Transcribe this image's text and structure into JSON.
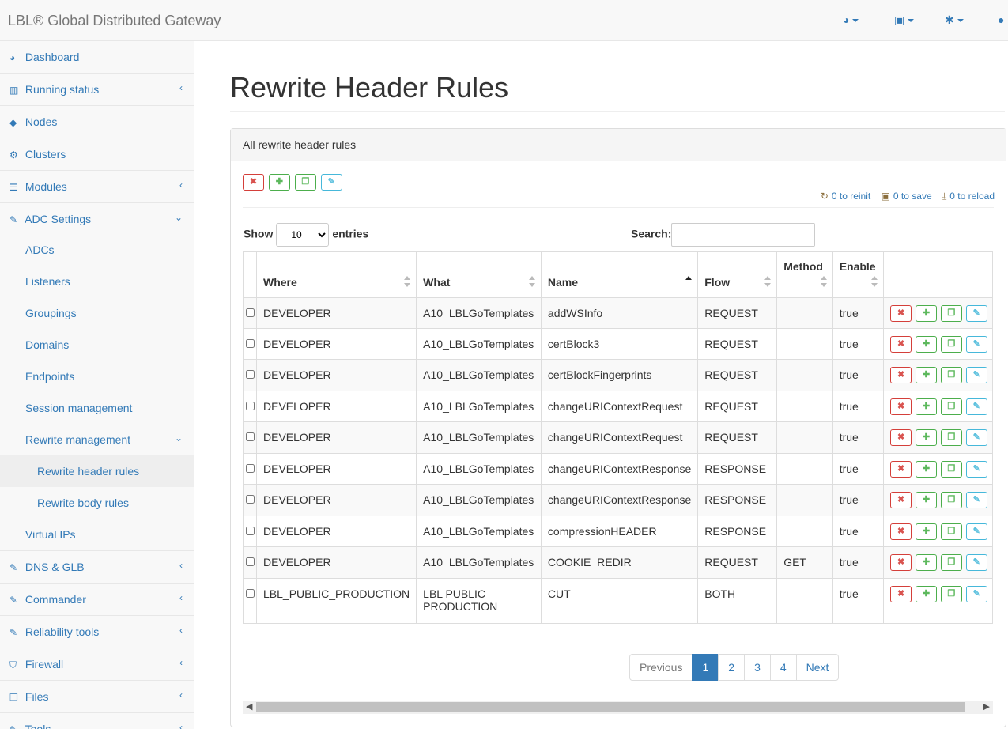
{
  "app": {
    "title": "LBL® Global Distributed Gateway"
  },
  "navbar": {
    "icons": [
      "dashboard-icon",
      "save-icon",
      "gear-icon",
      "user-icon"
    ]
  },
  "sidebar": {
    "items": [
      {
        "label": "Dashboard",
        "icon": "dashboard-icon",
        "chevron": ""
      },
      {
        "label": "Running status",
        "icon": "bar-chart-icon",
        "chevron": "‹"
      },
      {
        "label": "Nodes",
        "icon": "cube-icon",
        "chevron": ""
      },
      {
        "label": "Clusters",
        "icon": "cogs-icon",
        "chevron": ""
      },
      {
        "label": "Modules",
        "icon": "list-icon",
        "chevron": "‹"
      },
      {
        "label": "ADC Settings",
        "icon": "edit-icon",
        "chevron": "⌄"
      }
    ],
    "adc_sub": [
      "ADCs",
      "Listeners",
      "Groupings",
      "Domains",
      "Endpoints",
      "Session management"
    ],
    "rewrite_management": "Rewrite management",
    "rewrite_sub": [
      "Rewrite header rules",
      "Rewrite body rules"
    ],
    "virtual_ips": "Virtual IPs",
    "bottom_items": [
      {
        "label": "DNS & GLB",
        "icon": "edit-icon"
      },
      {
        "label": "Commander",
        "icon": "edit-icon"
      },
      {
        "label": "Reliability tools",
        "icon": "edit-icon"
      },
      {
        "label": "Firewall",
        "icon": "shield-icon"
      },
      {
        "label": "Files",
        "icon": "files-icon"
      },
      {
        "label": "Tools",
        "icon": "wrench-icon"
      }
    ]
  },
  "page": {
    "title": "Rewrite Header Rules",
    "panel_heading": "All rewrite header rules",
    "counters": {
      "reinit": "0 to reinit",
      "save": "0 to save",
      "reload": "0 to reload"
    },
    "length": {
      "show": "Show",
      "value": "10",
      "entries": "entries"
    },
    "search_label": "Search:"
  },
  "table": {
    "headers": [
      "Where",
      "What",
      "Name",
      "Flow",
      "Method",
      "Enable"
    ],
    "rows": [
      {
        "where": "DEVELOPER",
        "what": "A10_LBLGoTemplates",
        "name": "addWSInfo",
        "flow": "REQUEST",
        "method": "",
        "enable": "true"
      },
      {
        "where": "DEVELOPER",
        "what": "A10_LBLGoTemplates",
        "name": "certBlock3",
        "flow": "REQUEST",
        "method": "",
        "enable": "true"
      },
      {
        "where": "DEVELOPER",
        "what": "A10_LBLGoTemplates",
        "name": "certBlockFingerprints",
        "flow": "REQUEST",
        "method": "",
        "enable": "true"
      },
      {
        "where": "DEVELOPER",
        "what": "A10_LBLGoTemplates",
        "name": "changeURIContextRequest",
        "flow": "REQUEST",
        "method": "",
        "enable": "true"
      },
      {
        "where": "DEVELOPER",
        "what": "A10_LBLGoTemplates",
        "name": "changeURIContextRequest",
        "flow": "REQUEST",
        "method": "",
        "enable": "true"
      },
      {
        "where": "DEVELOPER",
        "what": "A10_LBLGoTemplates",
        "name": "changeURIContextResponse",
        "flow": "RESPONSE",
        "method": "",
        "enable": "true"
      },
      {
        "where": "DEVELOPER",
        "what": "A10_LBLGoTemplates",
        "name": "changeURIContextResponse",
        "flow": "RESPONSE",
        "method": "",
        "enable": "true"
      },
      {
        "where": "DEVELOPER",
        "what": "A10_LBLGoTemplates",
        "name": "compressionHEADER",
        "flow": "RESPONSE",
        "method": "",
        "enable": "true"
      },
      {
        "where": "DEVELOPER",
        "what": "A10_LBLGoTemplates",
        "name": "COOKIE_REDIR",
        "flow": "REQUEST",
        "method": "GET",
        "enable": "true"
      },
      {
        "where": "LBL_PUBLIC_PRODUCTION",
        "what": "LBL PUBLIC PRODUCTION",
        "name": "CUT",
        "flow": "BOTH",
        "method": "",
        "enable": "true"
      }
    ]
  },
  "pagination": {
    "previous": "Previous",
    "pages": [
      "1",
      "2",
      "3",
      "4"
    ],
    "current": "1",
    "next": "Next"
  },
  "colors": {
    "accent": "#337ab7",
    "danger": "#d9534f",
    "success": "#5cb85c",
    "info": "#5bc0de"
  }
}
